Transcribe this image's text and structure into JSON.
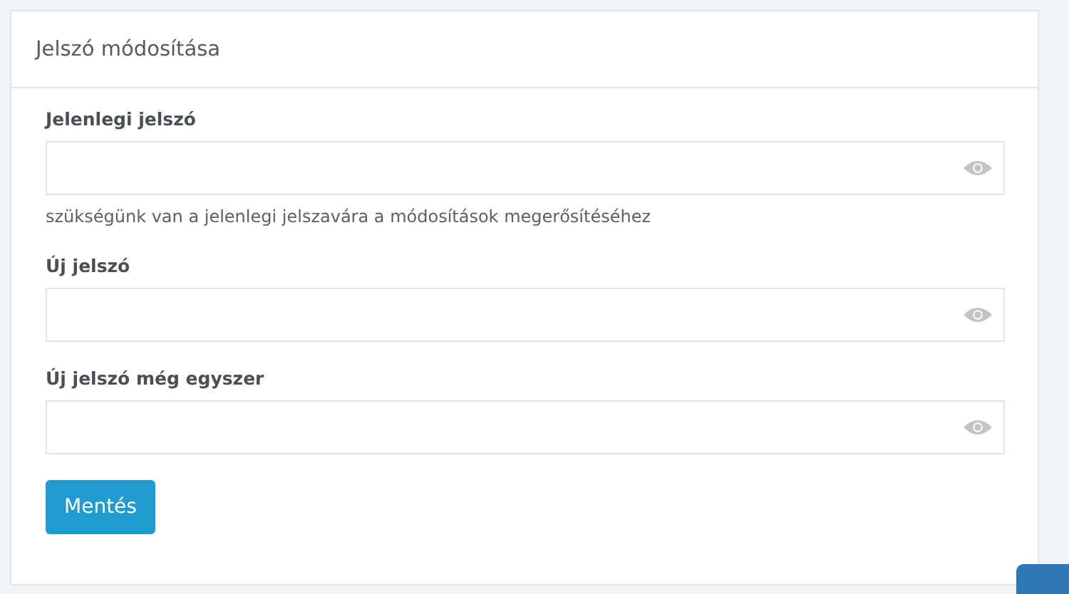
{
  "card": {
    "title": "Jelszó módosítása"
  },
  "fields": [
    {
      "label": "Jelenlegi jelszó",
      "help": "szükségünk van a jelenlegi jelszavára a módosítások megerősítéséhez"
    },
    {
      "label": "Új jelszó"
    },
    {
      "label": "Új jelszó még egyszer"
    }
  ],
  "save_button": "Mentés"
}
